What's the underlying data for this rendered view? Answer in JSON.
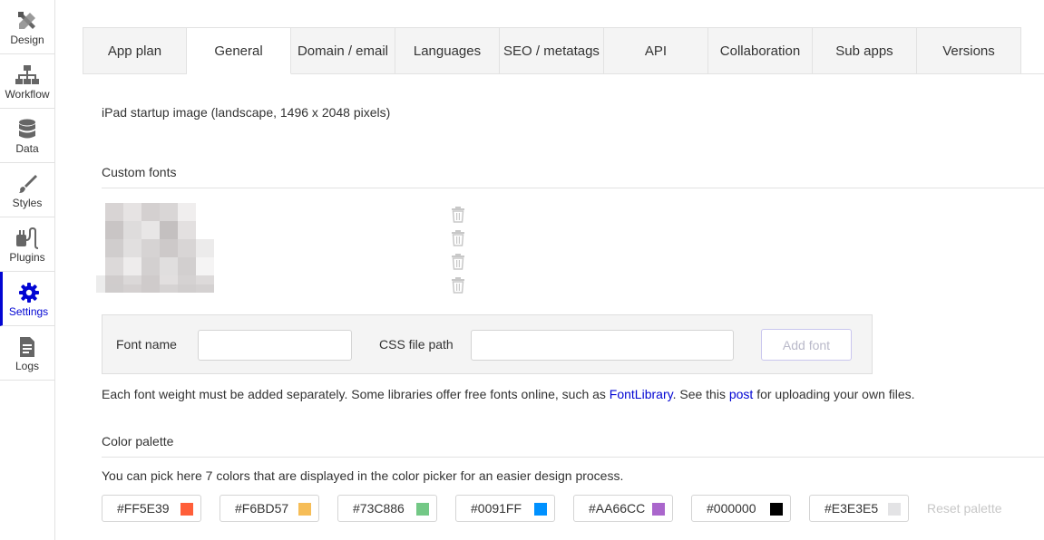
{
  "sidebar": {
    "items": [
      {
        "label": "Design",
        "icon": "design-icon",
        "active": false
      },
      {
        "label": "Workflow",
        "icon": "workflow-icon",
        "active": false
      },
      {
        "label": "Data",
        "icon": "database-icon",
        "active": false
      },
      {
        "label": "Styles",
        "icon": "brush-icon",
        "active": false
      },
      {
        "label": "Plugins",
        "icon": "plug-icon",
        "active": false
      },
      {
        "label": "Settings",
        "icon": "gear-icon",
        "active": true
      },
      {
        "label": "Logs",
        "icon": "document-icon",
        "active": false
      }
    ]
  },
  "tabs": [
    "App plan",
    "General",
    "Domain / email",
    "Languages",
    "SEO / metatags",
    "API",
    "Collaboration",
    "Sub apps",
    "Versions"
  ],
  "active_tab": "General",
  "ipad_startup_label": "iPad startup image (landscape, 1496 x 2048 pixels)",
  "custom_fonts": {
    "title": "Custom fonts",
    "font_name_label": "Font name",
    "font_name_value": "",
    "css_path_label": "CSS file path",
    "css_path_value": "",
    "add_button": "Add font",
    "help_before": "Each font weight must be added separately. Some libraries offer free fonts online, such as ",
    "help_link1": "FontLibrary",
    "help_middle": ". See this ",
    "help_link2": "post",
    "help_after": " for uploading your own files."
  },
  "color_palette": {
    "title": "Color palette",
    "description": "You can pick here 7 colors that are displayed in the color picker for an easier design process.",
    "colors": [
      "#FF5E39",
      "#F6BD57",
      "#73C886",
      "#0091FF",
      "#AA66CC",
      "#000000",
      "#E3E3E5"
    ],
    "reset_label": "Reset palette"
  },
  "accent_color": "#0205D3"
}
